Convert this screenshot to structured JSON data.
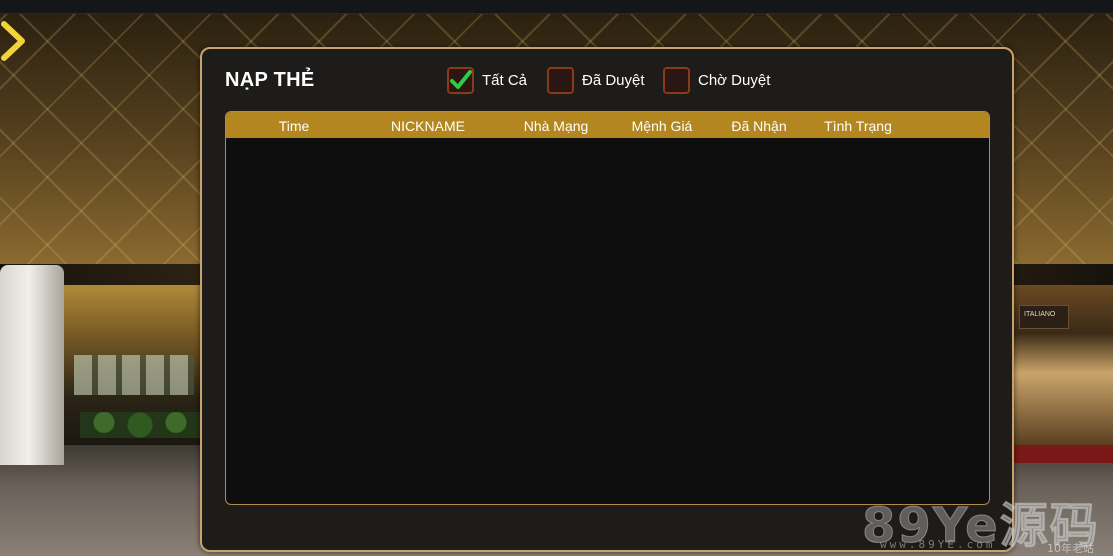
{
  "panel": {
    "title": "NẠP THẺ"
  },
  "filters": [
    {
      "label": "Tất Cả",
      "checked": true
    },
    {
      "label": "Đã Duyệt",
      "checked": false
    },
    {
      "label": "Chờ Duyệt",
      "checked": false
    }
  ],
  "table": {
    "columns": [
      "Time",
      "NICKNAME",
      "Nhà Mạng",
      "Mệnh Giá",
      "Đã Nhận",
      "Tình Trạng"
    ],
    "rows": []
  },
  "background": {
    "shop_sign": "ITALIANO"
  },
  "watermark": {
    "logo": "89Ye源码",
    "url": "www.89YE.com",
    "tag": "10年老站"
  },
  "colors": {
    "accent_gold": "#b4861f",
    "panel_border": "#c9a26a",
    "check_green": "#2ecc40",
    "back_arrow": "#f2d33a"
  },
  "icons": {
    "back": "chevron-right-icon",
    "check": "checkmark-icon"
  }
}
